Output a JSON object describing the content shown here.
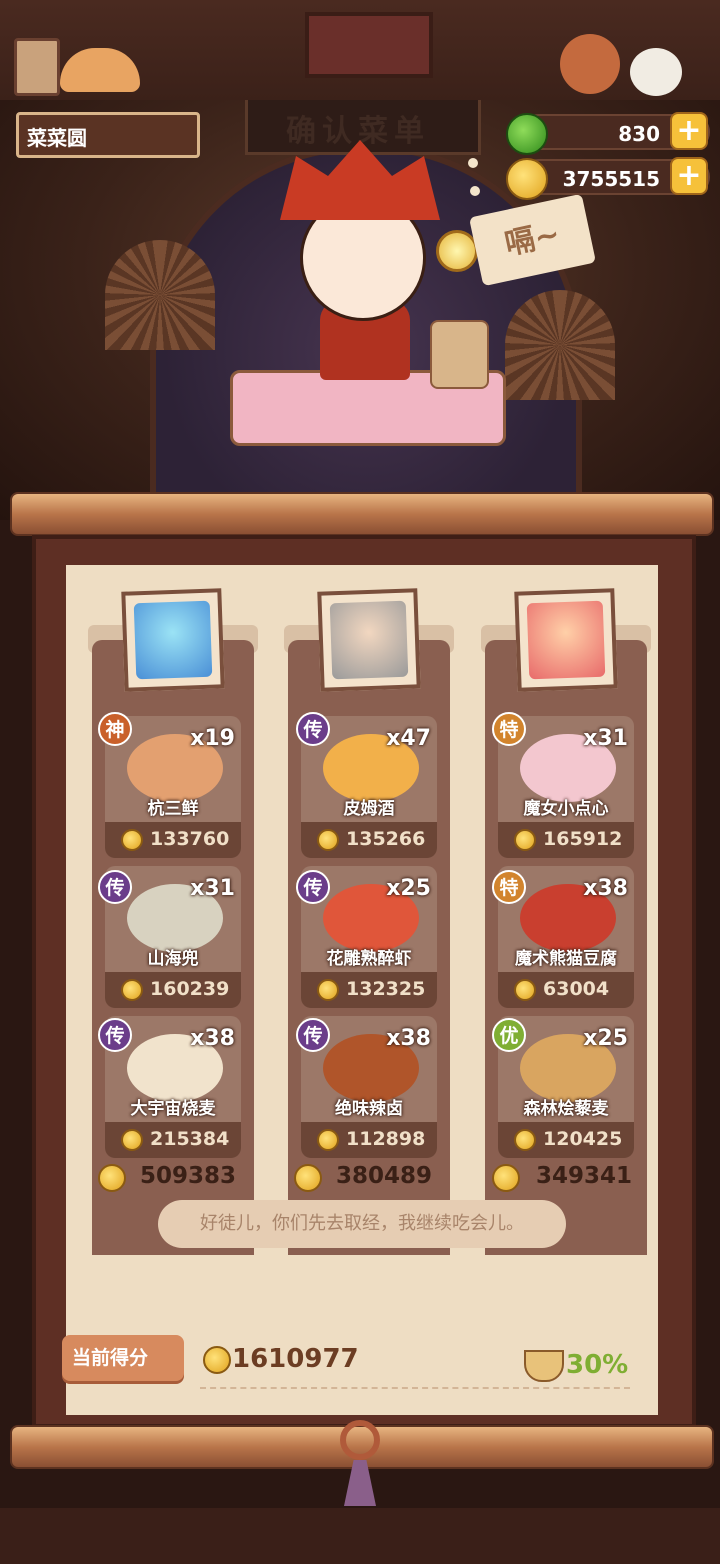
{
  "header": {
    "player_name": "菜菜圆",
    "sign_text": "确认菜单",
    "jade": "830",
    "coins": "3755515"
  },
  "speech": "嗝~",
  "columns": [
    {
      "total": "509383",
      "dishes": [
        {
          "rarity": "神",
          "rarity_color": "#c9602a",
          "count": "x19",
          "name": "杭三鲜",
          "price": "133760",
          "color": "#e3a070"
        },
        {
          "rarity": "传",
          "rarity_color": "#6b3d8a",
          "count": "x31",
          "name": "山海兜",
          "price": "160239",
          "color": "#d8d2c0"
        },
        {
          "rarity": "传",
          "rarity_color": "#6b3d8a",
          "count": "x38",
          "name": "大宇宙烧麦",
          "price": "215384",
          "color": "#f1e3cc"
        }
      ]
    },
    {
      "total": "380489",
      "dishes": [
        {
          "rarity": "传",
          "rarity_color": "#6b3d8a",
          "count": "x47",
          "name": "皮姆酒",
          "price": "135266",
          "color": "#f2b04a"
        },
        {
          "rarity": "传",
          "rarity_color": "#6b3d8a",
          "count": "x25",
          "name": "花雕熟醉虾",
          "price": "132325",
          "color": "#e0563a"
        },
        {
          "rarity": "传",
          "rarity_color": "#6b3d8a",
          "count": "x38",
          "name": "绝味辣卤",
          "price": "112898",
          "color": "#b0552a"
        }
      ]
    },
    {
      "total": "349341",
      "dishes": [
        {
          "rarity": "特",
          "rarity_color": "#d2842d",
          "count": "x31",
          "name": "魔女小点心",
          "price": "165912",
          "color": "#f3c7cf"
        },
        {
          "rarity": "特",
          "rarity_color": "#d2842d",
          "count": "x38",
          "name": "魔术熊猫豆腐",
          "price": "63004",
          "color": "#c93f2f"
        },
        {
          "rarity": "优",
          "rarity_color": "#7fae33",
          "count": "x25",
          "name": "森林烩藜麦",
          "price": "120425",
          "color": "#d9a560"
        }
      ]
    }
  ],
  "tip": "好徒儿，你们先去取经，我继续吃会儿。",
  "score": {
    "label": "当前得分",
    "value": "1610977",
    "bonus": "30%"
  },
  "colors": {
    "accent_gold": "#f6c13a",
    "bonus_green": "#7fae33"
  }
}
